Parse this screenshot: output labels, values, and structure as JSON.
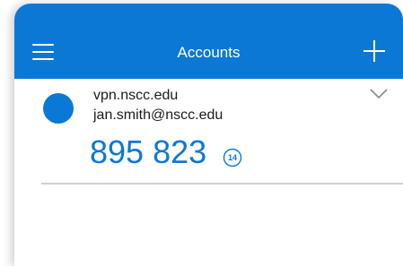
{
  "header": {
    "title": "Accounts",
    "menu_icon": "hamburger-menu-icon",
    "add_icon": "plus-icon",
    "color": "#0B78D6"
  },
  "accounts": [
    {
      "issuer": "vpn.nscc.edu",
      "username": "jan.smith@nscc.edu",
      "code": "895 823",
      "seconds_remaining": "14",
      "expand_icon": "chevron-down-icon"
    }
  ]
}
